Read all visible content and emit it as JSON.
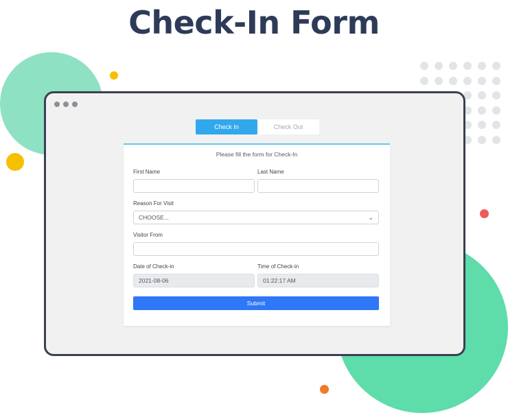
{
  "page": {
    "title": "Check-In Form"
  },
  "tabs": [
    {
      "label": "Check In",
      "active": true
    },
    {
      "label": "Check Out",
      "active": false
    }
  ],
  "form": {
    "heading": "Please fill the form for Check-In",
    "first_name": {
      "label": "First Name",
      "value": ""
    },
    "last_name": {
      "label": "Last Name",
      "value": ""
    },
    "reason": {
      "label": "Reason For Visit",
      "selected": "CHOOSE..."
    },
    "visitor_from": {
      "label": "Visitor From",
      "value": ""
    },
    "date": {
      "label": "Date of Check-in",
      "value": "2021-08-06"
    },
    "time": {
      "label": "Time of Check-in",
      "value": "01:22:17 AM"
    },
    "submit_label": "Submit"
  },
  "colors": {
    "accent": "#2e77f6",
    "tab_active": "#32a8ec",
    "title": "#2e3b58",
    "card_top_border": "#65c9ec"
  },
  "icons": {
    "select": "chevron-down-icon"
  }
}
